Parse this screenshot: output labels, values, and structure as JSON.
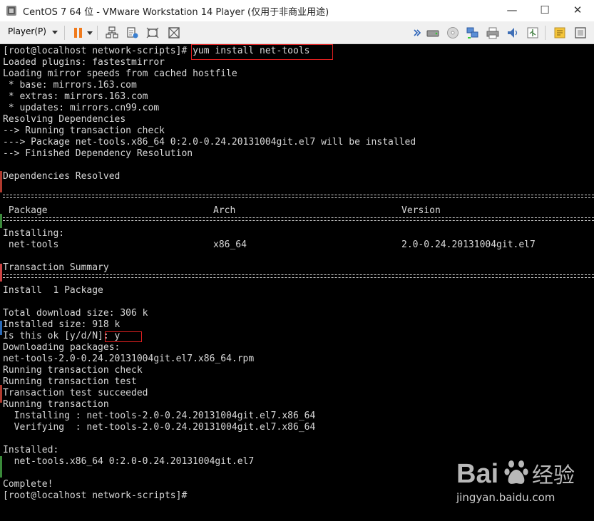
{
  "window": {
    "title": "CentOS 7 64 位 - VMware Workstation 14 Player (仅用于非商业用途)",
    "minimize_glyph": "—",
    "maximize_glyph": "☐",
    "close_glyph": "✕"
  },
  "toolbar": {
    "player_menu_label": "Player(P)",
    "left_icons": [
      "pause-icon",
      "send-ctrl-alt-del-icon",
      "vm-settings-icon",
      "fit-guest-icon",
      "unity-icon"
    ],
    "right_icons": [
      "more-chevron-icon",
      "hard-disk-icon",
      "cd-dvd-icon",
      "network-adapter-icon",
      "printer-icon",
      "sound-card-icon",
      "usb-icon",
      "message-log-icon",
      "fullscreen-icon"
    ]
  },
  "terminal": {
    "lines": [
      "[root@localhost network-scripts]# yum install net-tools",
      "Loaded plugins: fastestmirror",
      "Loading mirror speeds from cached hostfile",
      " * base: mirrors.163.com",
      " * extras: mirrors.163.com",
      " * updates: mirrors.cn99.com",
      "Resolving Dependencies",
      "--> Running transaction check",
      "---> Package net-tools.x86_64 0:2.0-0.24.20131004git.el7 will be installed",
      "--> Finished Dependency Resolution",
      "",
      "Dependencies Resolved",
      "",
      "",
      "",
      "",
      "Installing:",
      "",
      "",
      "Transaction Summary",
      "",
      "Install  1 Package",
      "",
      "Total download size: 306 k",
      "Installed size: 918 k",
      "Is this ok [y/d/N]: y",
      "Downloading packages:",
      "net-tools-2.0-0.24.20131004git.el7.x86_64.rpm",
      "Running transaction check",
      "Running transaction test",
      "Transaction test succeeded",
      "Running transaction",
      "  Installing : net-tools-2.0-0.24.20131004git.el7.x86_64",
      "  Verifying  : net-tools-2.0-0.24.20131004git.el7.x86_64",
      "",
      "Installed:",
      "  net-tools.x86_64 0:2.0-0.24.20131004git.el7",
      "",
      "Complete!",
      "[root@localhost network-scripts]#"
    ],
    "table": {
      "headers": [
        " Package",
        "Arch",
        "Version"
      ],
      "row": [
        " net-tools",
        "x86_64",
        "2.0-0.24.20131004git.el7"
      ]
    },
    "colors": {
      "foreground": "#d8d8d8",
      "background": "#000000",
      "highlight": "#e02020"
    }
  },
  "watermark": {
    "logo_text": "Bai",
    "logo_suffix": "经验",
    "sub_text": "jingyan.baidu.com"
  }
}
